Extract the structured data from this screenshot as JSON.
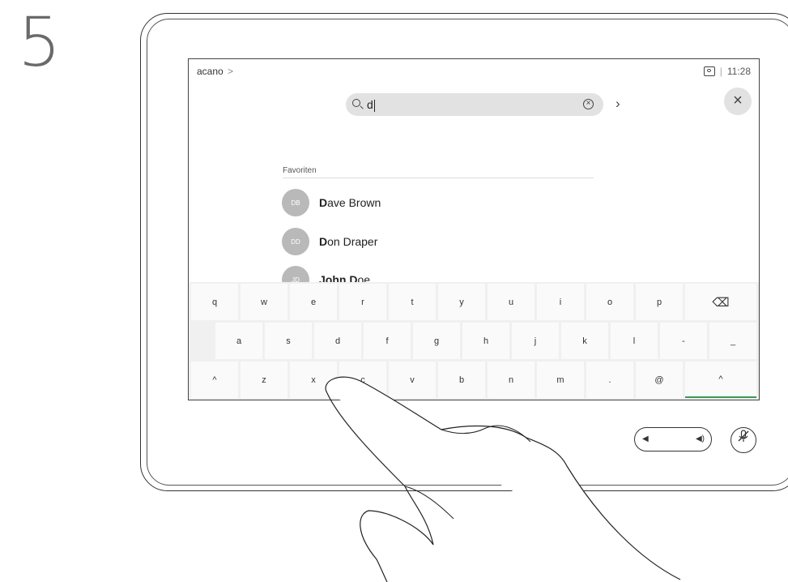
{
  "step": {
    "number": "5"
  },
  "header": {
    "breadcrumb": "acano",
    "breadcrumb_sep": ">",
    "time": "11:28",
    "divider": "|"
  },
  "search": {
    "value": "d",
    "next_glyph": "›",
    "clear_glyph": "×"
  },
  "close": {
    "glyph": "×"
  },
  "favorites": {
    "label": "Favoriten",
    "contacts": [
      {
        "initials": "DB",
        "name_bold": "D",
        "name_rest": "ave Brown"
      },
      {
        "initials": "DD",
        "name_bold": "D",
        "name_rest": "on Draper"
      },
      {
        "initials": "JD",
        "name_bold": "John D",
        "name_rest": "oe"
      }
    ]
  },
  "keyboard": {
    "row1": [
      "q",
      "w",
      "e",
      "r",
      "t",
      "y",
      "u",
      "i",
      "o",
      "p"
    ],
    "row1_backspace": "⌫",
    "row2": [
      "a",
      "s",
      "d",
      "f",
      "g",
      "h",
      "j",
      "k",
      "l",
      "-",
      "_"
    ],
    "row3": [
      "^",
      "z",
      "x",
      "c",
      "v",
      "b",
      "n",
      "m",
      ".",
      "@",
      "^"
    ]
  },
  "controls": {
    "vol_down": "◀",
    "vol_up": "◀)",
    "mute": "🎤"
  },
  "colors": {
    "accent": "#2ca14a",
    "avatar": "#b9b9b9",
    "search_bg": "#e2e2e2"
  }
}
